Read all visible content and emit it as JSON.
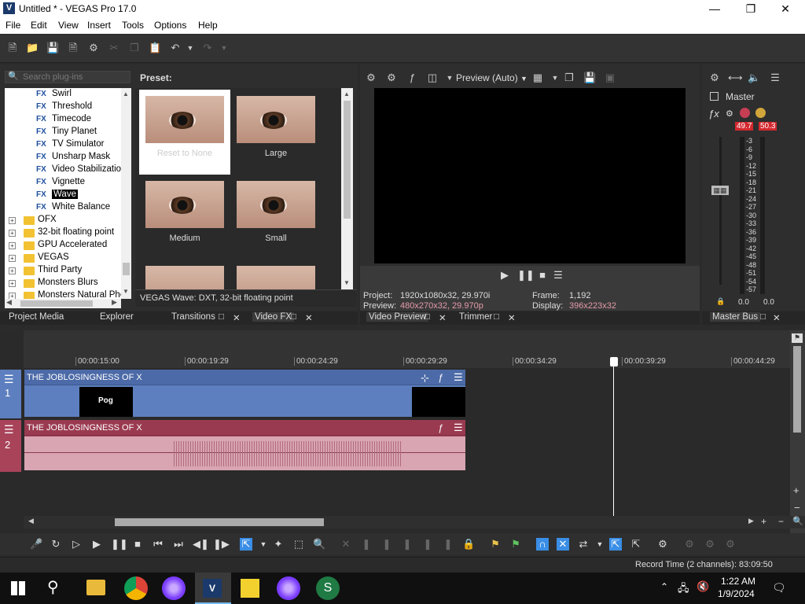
{
  "window": {
    "title": "Untitled * - VEGAS Pro 17.0",
    "app_icon": "V"
  },
  "menu": [
    "File",
    "Edit",
    "View",
    "Insert",
    "Tools",
    "Options",
    "Help"
  ],
  "fx_panel": {
    "search_placeholder": "Search plug-ins",
    "preset_label": "Preset:",
    "tree_items": [
      {
        "label": "Swirl",
        "kind": "fx"
      },
      {
        "label": "Threshold",
        "kind": "fx"
      },
      {
        "label": "Timecode",
        "kind": "fx"
      },
      {
        "label": "Tiny Planet",
        "kind": "fx"
      },
      {
        "label": "TV Simulator",
        "kind": "fx"
      },
      {
        "label": "Unsharp Mask",
        "kind": "fx"
      },
      {
        "label": "Video Stabilization",
        "kind": "fx"
      },
      {
        "label": "Vignette",
        "kind": "fx"
      },
      {
        "label": "Wave",
        "kind": "fx",
        "selected": true
      },
      {
        "label": "White Balance",
        "kind": "fx"
      },
      {
        "label": "OFX",
        "kind": "folder"
      },
      {
        "label": "32-bit floating point",
        "kind": "folder"
      },
      {
        "label": "GPU Accelerated",
        "kind": "folder"
      },
      {
        "label": "VEGAS",
        "kind": "folder"
      },
      {
        "label": "Third Party",
        "kind": "folder"
      },
      {
        "label": "Monsters Blurs",
        "kind": "folder"
      },
      {
        "label": "Monsters Natural Phe",
        "kind": "folder"
      }
    ],
    "fx_badge": "FX",
    "presets": [
      "Reset to None",
      "Large",
      "Medium",
      "Small"
    ],
    "status": "VEGAS Wave: DXT, 32-bit floating point"
  },
  "bottom_tabs_left": [
    "Project Media",
    "Explorer",
    "Transitions",
    "Video FX"
  ],
  "preview": {
    "mode": "Preview (Auto)",
    "project_label": "Project:",
    "project_value": "1920x1080x32, 29.970i",
    "preview_label": "Preview:",
    "preview_value": "480x270x32, 29.970p",
    "frame_label": "Frame:",
    "frame_value": "1,192",
    "display_label": "Display:",
    "display_value": "396x223x32",
    "tabs": [
      "Video Preview",
      "Trimmer"
    ]
  },
  "master": {
    "label": "Master",
    "peak_left": "49.7",
    "peak_right": "50.3",
    "scale": [
      "3",
      "6",
      "9",
      "12",
      "15",
      "18",
      "21",
      "24",
      "27",
      "30",
      "33",
      "36",
      "39",
      "42",
      "45",
      "48",
      "51",
      "54",
      "57"
    ],
    "level_left": "0.0",
    "level_right": "0.0",
    "tab": "Master Bus"
  },
  "timeline": {
    "ruler": [
      "00:00:15:00",
      "00:00:19:29",
      "00:00:24:29",
      "00:00:29:29",
      "00:00:34:29",
      "00:00:39:29",
      "00:00:44:29"
    ],
    "tracks": [
      {
        "number": "1",
        "name": "THE JOBLOSINGNESS OF X",
        "type": "video",
        "clip_label": "Pog"
      },
      {
        "number": "2",
        "name": "THE JOBLOSINGNESS OF X",
        "type": "audio"
      }
    ]
  },
  "status_bar": {
    "record_time": "Record Time (2 channels): 83:09:50"
  },
  "taskbar": {
    "time": "1:22 AM",
    "date": "1/9/2024"
  },
  "colors": {
    "video_track": "#5d7fbf",
    "audio_track": "#a8435a",
    "audio_clip": "#d9a5b3",
    "accent": "#3a8ee6"
  }
}
